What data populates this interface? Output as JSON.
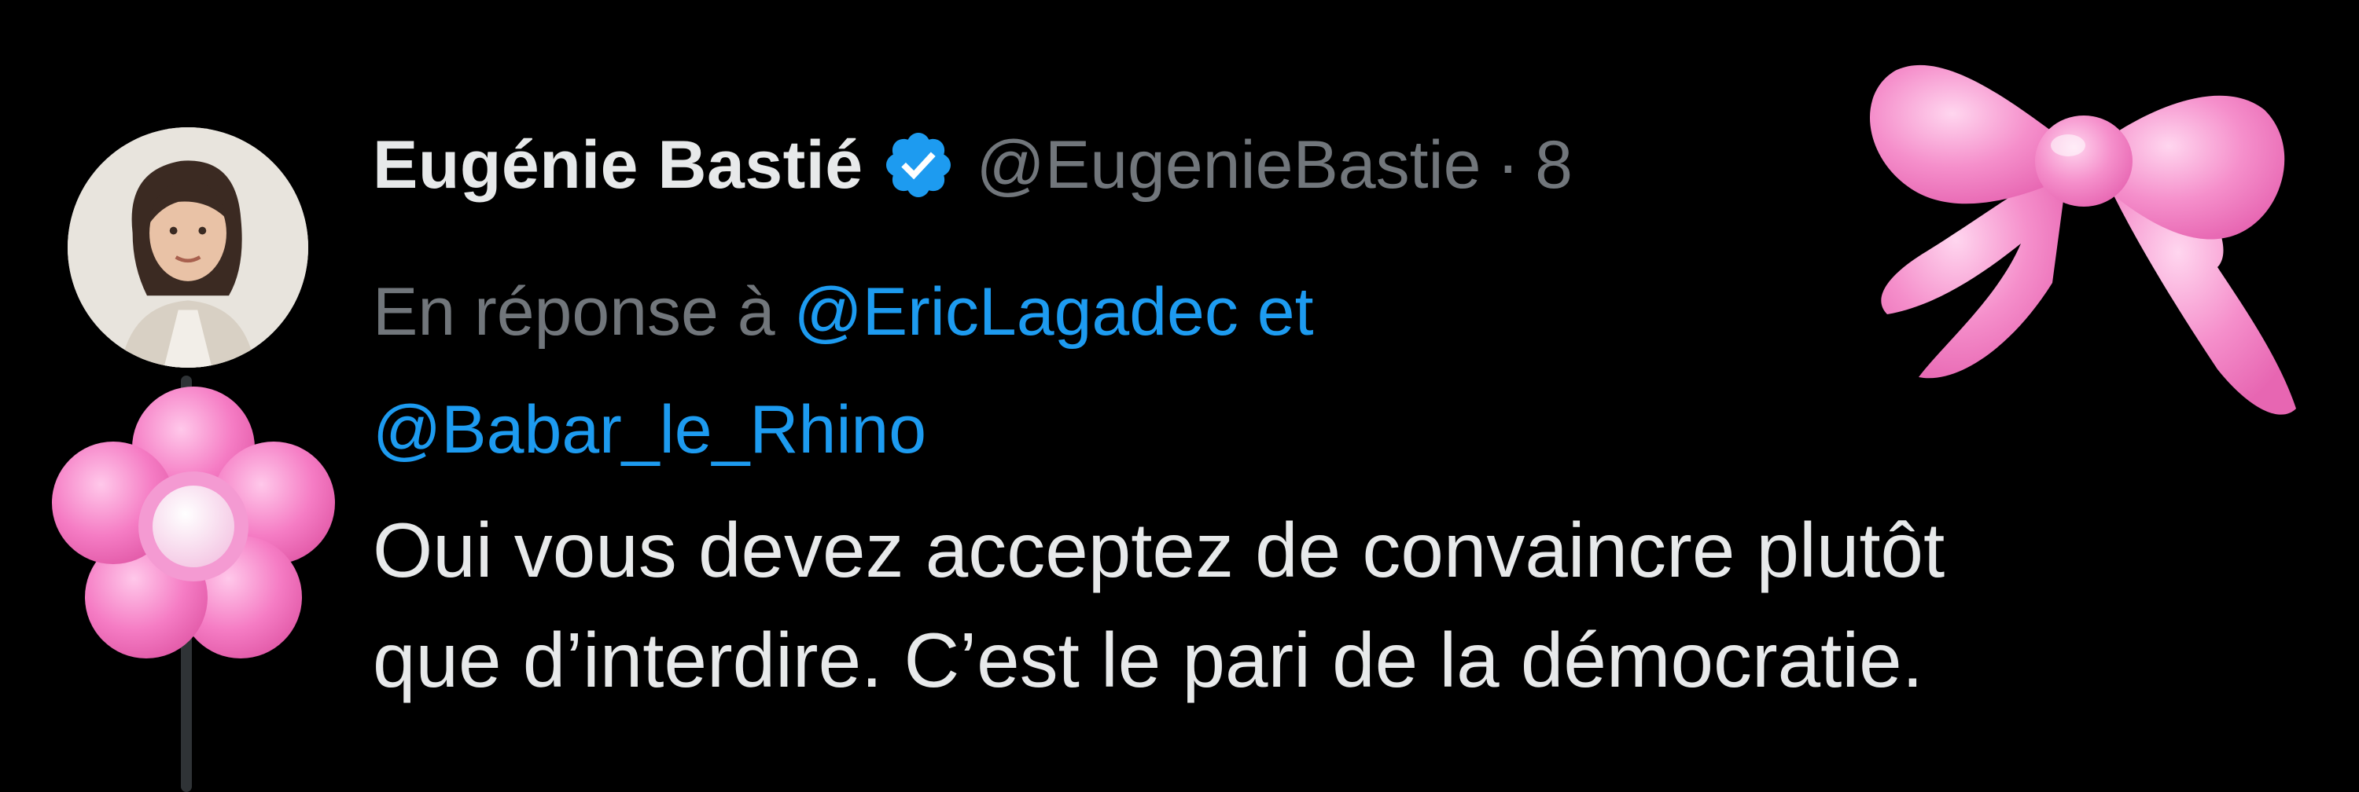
{
  "tweet": {
    "display_name": "Eugénie Bastié",
    "handle": "@EugenieBastie",
    "separator": "·",
    "date_fragment": "8",
    "reply_prefix": "En réponse à",
    "reply_mention_1": "@EricLagadec",
    "reply_conjunction": "et",
    "reply_mention_2": "@Babar_le_Rhino",
    "text_line_1": "Oui vous devez acceptez de convaincre plutôt",
    "text_line_2": "que d’interdire. C’est le pari de la démocratie."
  },
  "colors": {
    "background": "#000000",
    "primary_text": "#e7e9ea",
    "secondary_text": "#71767b",
    "mention": "#1d9bf0",
    "verified_badge": "#1d9bf0",
    "sticker_pink": "#f47fc0"
  },
  "icons": {
    "verified": "verified-badge-icon",
    "bow": "pink-bow-sticker",
    "flower": "pink-flower-sticker"
  }
}
